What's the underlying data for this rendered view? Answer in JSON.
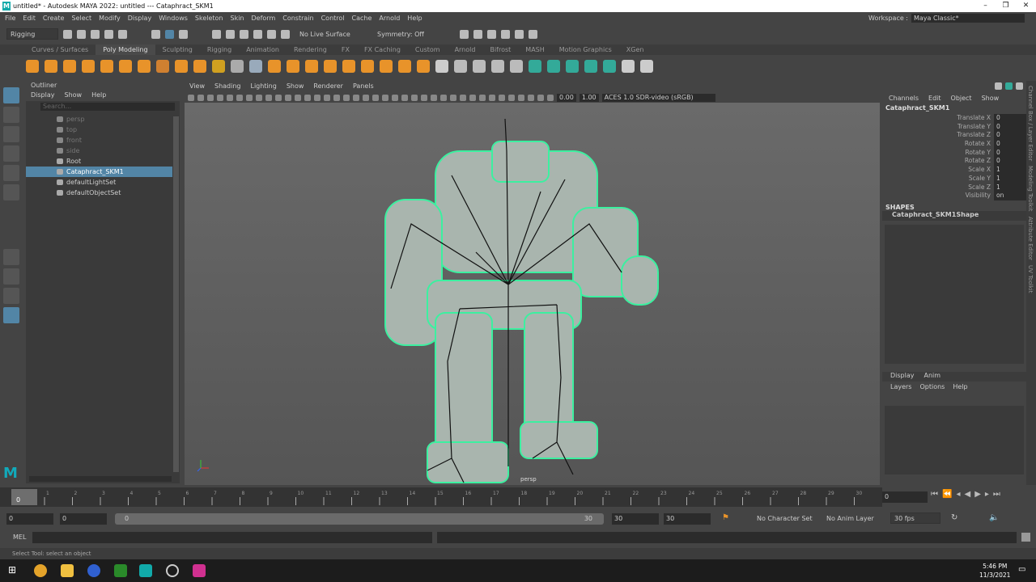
{
  "window": {
    "title": "untitled* - Autodesk MAYA 2022: untitled   ---   Cataphract_SKM1",
    "logo": "M",
    "minimize": "–",
    "maximize": "❐",
    "close": "✕"
  },
  "menubar": [
    "File",
    "Edit",
    "Create",
    "Select",
    "Modify",
    "Display",
    "Windows",
    "Skeleton",
    "Skin",
    "Deform",
    "Constrain",
    "Control",
    "Cache",
    "Arnold",
    "Help"
  ],
  "workspace": {
    "label": "Workspace :",
    "value": "Maya Classic*"
  },
  "statusline": {
    "menuset": "Rigging",
    "live_surface": "No Live Surface",
    "symmetry": "Symmetry: Off"
  },
  "shelf_tabs": [
    "Curves / Surfaces",
    "Poly Modeling",
    "Sculpting",
    "Rigging",
    "Animation",
    "Rendering",
    "FX",
    "FX Caching",
    "Custom",
    "Arnold",
    "Bifrost",
    "MASH",
    "Motion Graphics",
    "XGen"
  ],
  "shelf_active": "Poly Modeling",
  "outliner": {
    "title": "Outliner",
    "menu": [
      "Display",
      "Show",
      "Help"
    ],
    "search_placeholder": "Search...",
    "items": [
      {
        "label": "persp",
        "dim": true
      },
      {
        "label": "top",
        "dim": true
      },
      {
        "label": "front",
        "dim": true
      },
      {
        "label": "side",
        "dim": true
      },
      {
        "label": "Root"
      },
      {
        "label": "Cataphract_SKM1",
        "selected": true
      },
      {
        "label": "defaultLightSet"
      },
      {
        "label": "defaultObjectSet"
      }
    ]
  },
  "viewport": {
    "menu": [
      "View",
      "Shading",
      "Lighting",
      "Show",
      "Renderer",
      "Panels"
    ],
    "exposure": "0.00",
    "gamma": "1.00",
    "colorspace": "ACES 1.0 SDR-video (sRGB)",
    "camera_label": "persp"
  },
  "channelbox": {
    "menu": [
      "Channels",
      "Edit",
      "Object",
      "Show"
    ],
    "object": "Cataphract_SKM1",
    "channels": [
      {
        "name": "Translate X",
        "value": "0"
      },
      {
        "name": "Translate Y",
        "value": "0"
      },
      {
        "name": "Translate Z",
        "value": "0"
      },
      {
        "name": "Rotate X",
        "value": "0"
      },
      {
        "name": "Rotate Y",
        "value": "0"
      },
      {
        "name": "Rotate Z",
        "value": "0"
      },
      {
        "name": "Scale X",
        "value": "1"
      },
      {
        "name": "Scale Y",
        "value": "1"
      },
      {
        "name": "Scale Z",
        "value": "1"
      },
      {
        "name": "Visibility",
        "value": "on"
      }
    ],
    "shapes_label": "SHAPES",
    "shape": "Cataphract_SKM1Shape",
    "layer_tabs": [
      "Display",
      "Anim"
    ],
    "layer_menu": [
      "Layers",
      "Options",
      "Help"
    ]
  },
  "right_tabs": [
    "Channel Box / Layer Editor",
    "Modeling Toolkit",
    "Attribute Editor",
    "UV Toolkit"
  ],
  "timeline": {
    "ticks": [
      "1",
      "2",
      "3",
      "4",
      "5",
      "6",
      "7",
      "8",
      "9",
      "10",
      "11",
      "12",
      "13",
      "14",
      "15",
      "16",
      "17",
      "18",
      "19",
      "20",
      "21",
      "22",
      "23",
      "24",
      "25",
      "26",
      "27",
      "28",
      "29",
      "30"
    ],
    "current_frame": "0",
    "frame_field": "0"
  },
  "range": {
    "start": "0",
    "anim_start": "0",
    "slider_start": "0",
    "slider_end": "30",
    "end": "30",
    "anim_end": "30",
    "character_set": "No Character Set",
    "anim_layer": "No Anim Layer",
    "fps": "30 fps"
  },
  "cmdline": {
    "label": "MEL"
  },
  "helpline": "Select Tool: select an object",
  "taskbar": {
    "time": "5:46 PM",
    "date": "11/3/2021"
  },
  "colors": {
    "selection": "#5285a6",
    "mesh": "#3cf0a0",
    "accent": "#e8932a"
  }
}
